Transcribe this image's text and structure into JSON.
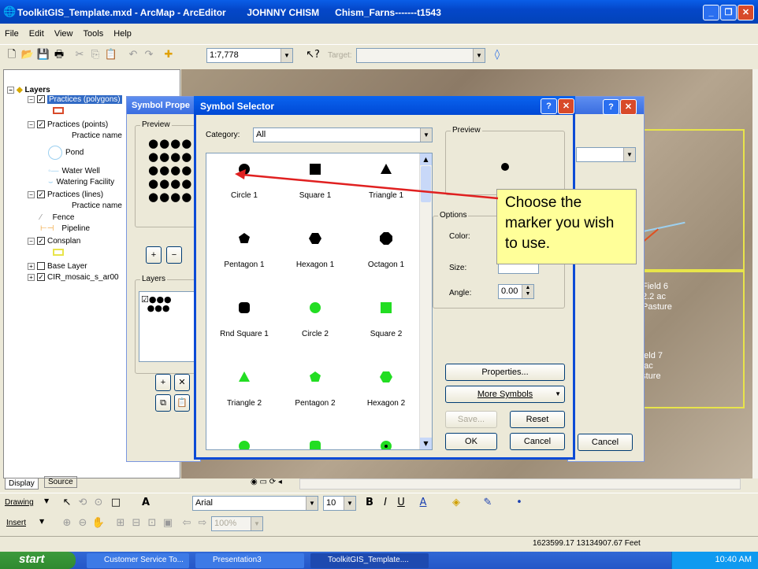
{
  "window": {
    "title": "ToolkitGIS_Template.mxd - ArcMap - ArcEditor        JOHNNY CHISM      Chism_Farns-------t1543"
  },
  "menu": [
    "File",
    "Edit",
    "View",
    "Tools",
    "Help"
  ],
  "toolbar": {
    "scale": "1:7,778",
    "target_label": "Target:"
  },
  "toc": {
    "layers_label": "Layers",
    "items": [
      {
        "label": "Practices (polygons)",
        "selected": true
      },
      {
        "label": "Practices (points)"
      },
      {
        "label": "Practice name"
      },
      {
        "label": "Pond"
      },
      {
        "label": "Water Well"
      },
      {
        "label": "Watering Facility"
      },
      {
        "label": "Practices (lines)"
      },
      {
        "label": "Practice name"
      },
      {
        "label": "Fence"
      },
      {
        "label": "Pipeline"
      },
      {
        "label": "Consplan"
      },
      {
        "label": "Base Layer"
      },
      {
        "label": "CIR_mosaic_s_ar00"
      }
    ],
    "tabs": [
      "Display",
      "Source"
    ]
  },
  "bg_dialog": {
    "title": "Symbol Prope",
    "preview_label": "Preview",
    "layers_label": "Layers",
    "cancel_label": "Cancel"
  },
  "symbol_selector": {
    "title": "Symbol Selector",
    "category_label": "Category:",
    "category_value": "All",
    "preview_label": "Preview",
    "options_label": "Options",
    "color_label": "Color:",
    "size_label": "Size:",
    "angle_label": "Angle:",
    "angle_value": "0.00",
    "symbols": [
      {
        "name": "Circle 1",
        "shape": "circle",
        "color": "#000000"
      },
      {
        "name": "Square 1",
        "shape": "square",
        "color": "#000000"
      },
      {
        "name": "Triangle 1",
        "shape": "triangle",
        "color": "#000000"
      },
      {
        "name": "Pentagon 1",
        "shape": "pentagon",
        "color": "#000000"
      },
      {
        "name": "Hexagon 1",
        "shape": "hexagon",
        "color": "#000000"
      },
      {
        "name": "Octagon 1",
        "shape": "octagon",
        "color": "#000000"
      },
      {
        "name": "Rnd Square 1",
        "shape": "rndsquare",
        "color": "#000000"
      },
      {
        "name": "Circle 2",
        "shape": "circle",
        "color": "#22dd22"
      },
      {
        "name": "Square 2",
        "shape": "square",
        "color": "#22dd22"
      },
      {
        "name": "Triangle 2",
        "shape": "triangle",
        "color": "#22dd22"
      },
      {
        "name": "Pentagon 2",
        "shape": "pentagon",
        "color": "#22dd22"
      },
      {
        "name": "Hexagon 2",
        "shape": "hexagon",
        "color": "#22dd22"
      }
    ],
    "buttons": {
      "properties": "Properties...",
      "more_symbols": "More Symbols",
      "save": "Save...",
      "reset": "Reset",
      "ok": "OK",
      "cancel": "Cancel"
    }
  },
  "callout": {
    "text": "Choose the marker you wish to use."
  },
  "map_labels": [
    "Field 6",
    "2.2 ac",
    "Pasture",
    "Field 7",
    "1 ac",
    "asture"
  ],
  "drawing_toolbar": {
    "drawing_label": "Drawing",
    "font": "Arial",
    "font_size": "10"
  },
  "insert_toolbar": {
    "insert_label": "Insert",
    "zoom": "100%"
  },
  "status": {
    "coordinates": "1623599.17  13134907.67 Feet"
  },
  "taskbar": {
    "start": "start",
    "tasks": [
      "Customer Service To...",
      "Presentation3",
      "ToolkitGIS_Template...."
    ],
    "clock": "10:40 AM"
  }
}
